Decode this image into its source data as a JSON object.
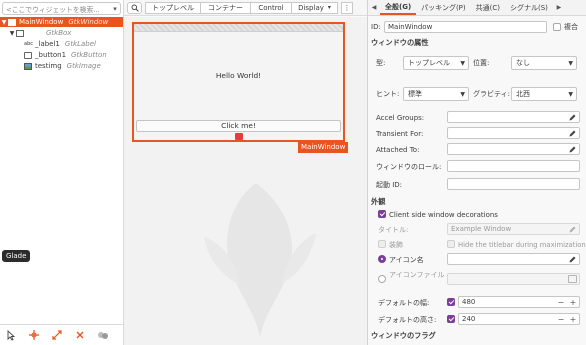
{
  "left": {
    "search_placeholder": "<ここでウィジェットを検索...",
    "tree": [
      {
        "name": "MainWindow",
        "cls": "GtkWindow",
        "selected": true
      },
      {
        "name": "",
        "cls": "GtkBox"
      },
      {
        "name": "_label1",
        "cls": "GtkLabel"
      },
      {
        "name": "_button1",
        "cls": "GtkButton"
      },
      {
        "name": "testimg",
        "cls": "GtkImage"
      }
    ],
    "tooltip": "Glade"
  },
  "center": {
    "categories": [
      "トップレベル",
      "コンテナー",
      "Control",
      "Display"
    ],
    "more": "⋮",
    "window_label": "Hello World!",
    "button_label": "Click me!",
    "window_tag": "MainWindow"
  },
  "right": {
    "tabs": [
      "全般(G)",
      "パッキング(P)",
      "共通(C)",
      "シグナル(S)"
    ],
    "id_label": "ID:",
    "id_value": "MainWindow",
    "composite_label": "複合",
    "window_attrs_title": "ウィンドウの属性",
    "type_label": "型:",
    "type_value": "トップレベル",
    "position_label": "位置:",
    "position_value": "なし",
    "hint_label": "ヒント:",
    "hint_value": "標準",
    "gravity_label": "グラビティ:",
    "gravity_value": "北西",
    "accel_label": "Accel Groups:",
    "transient_label": "Transient For:",
    "attached_label": "Attached To:",
    "role_label": "ウィンドウのロール:",
    "startup_label": "起動 ID:",
    "appearance_title": "外観",
    "csd_label": "Client side window decorations",
    "title_label": "タイトル:",
    "title_placeholder": "Example Window",
    "decorated_label": "装飾",
    "hide_titlebar_label": "Hide the titlebar during maximization",
    "icon_name_label": "アイコン名",
    "icon_file_label": "アイコンファイル",
    "default_width_label": "デフォルトの幅:",
    "default_width_value": "480",
    "default_height_label": "デフォルトの高さ:",
    "default_height_value": "240",
    "flags_title": "ウィンドウのフラグ"
  },
  "colors": {
    "accent": "#e95420",
    "check": "#7b3f98"
  }
}
